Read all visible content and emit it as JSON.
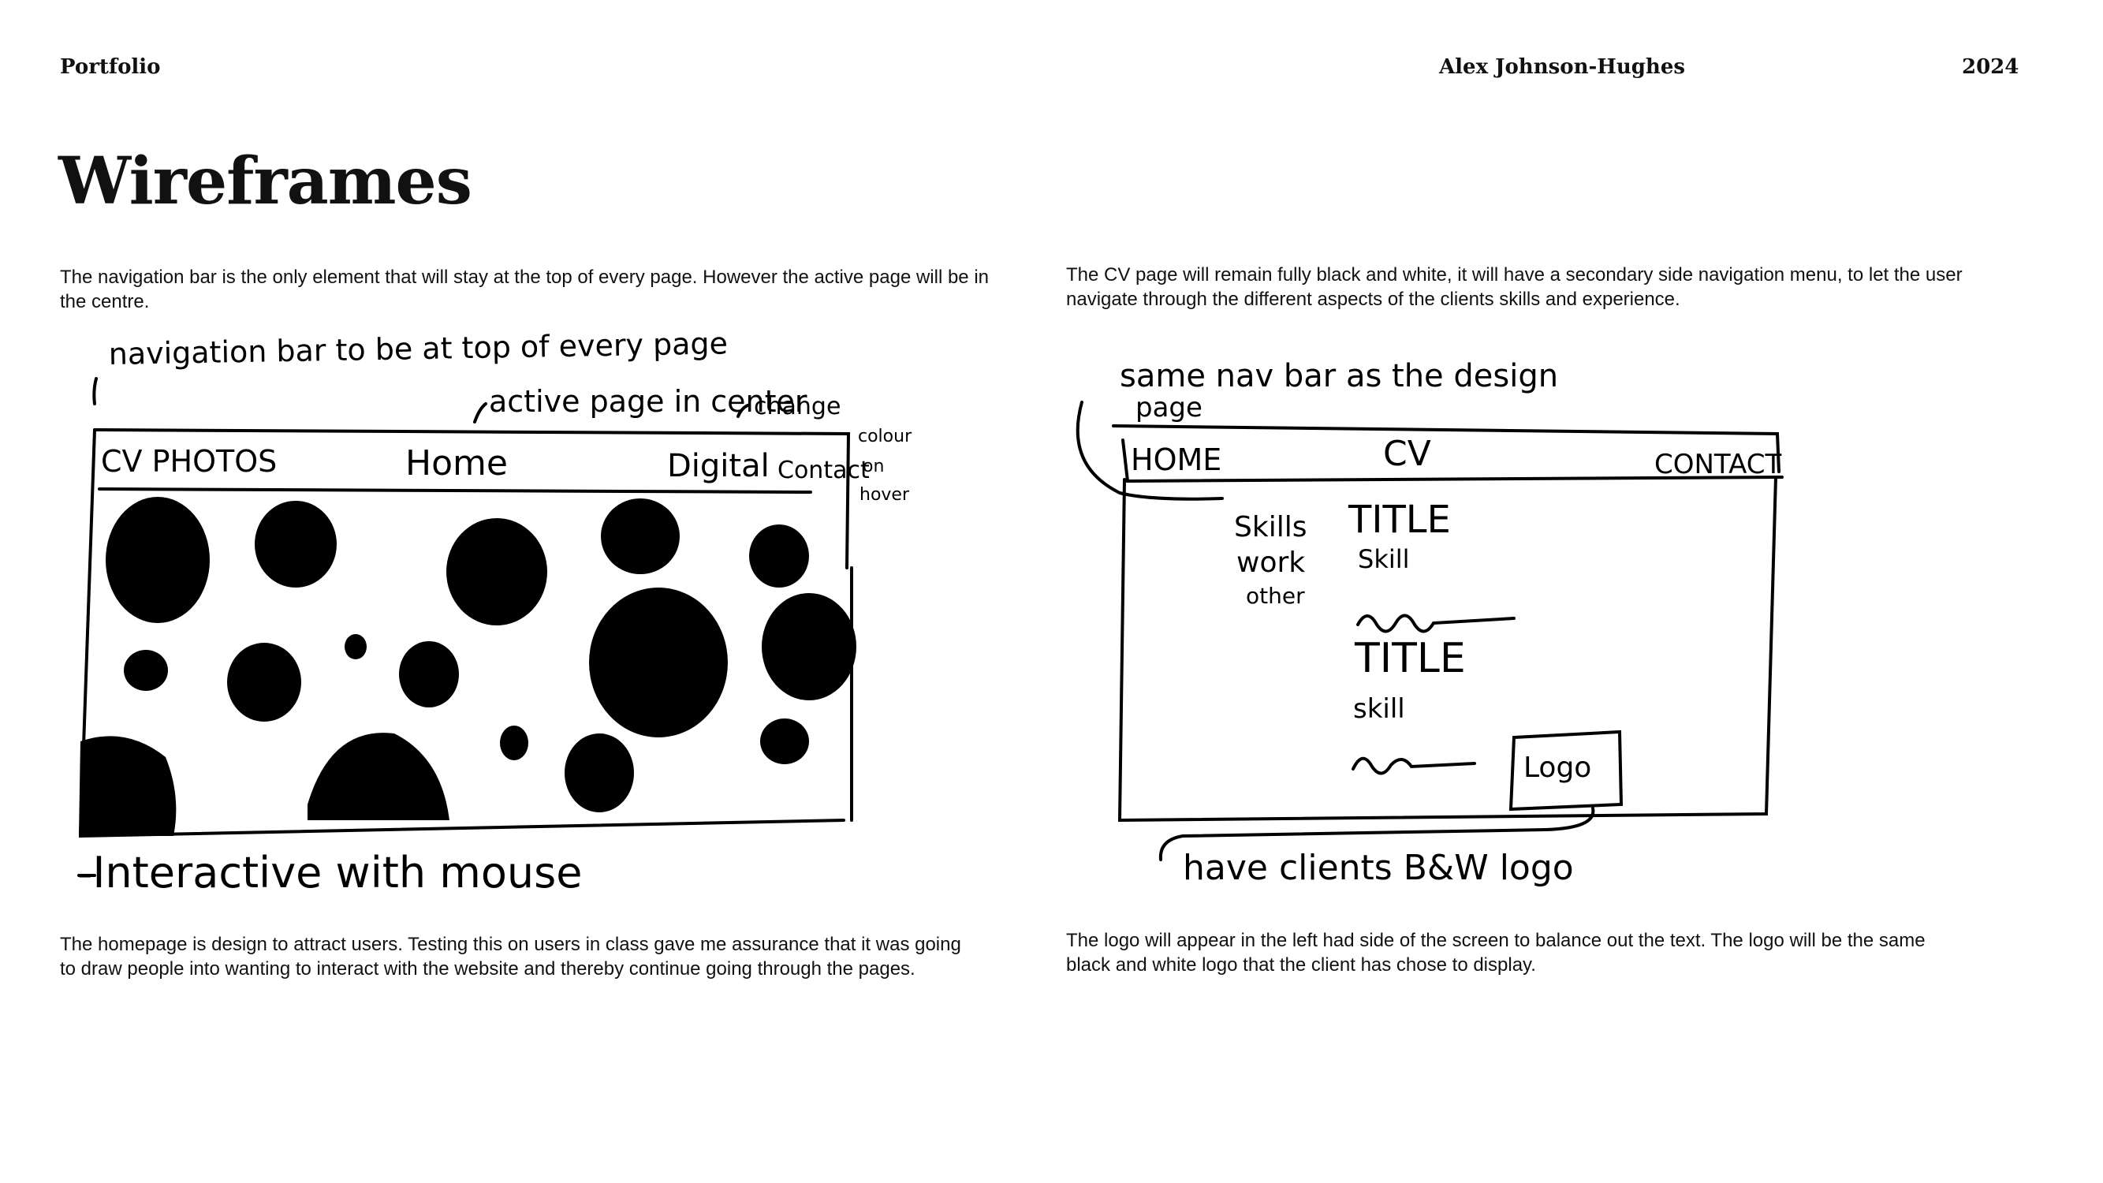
{
  "header": {
    "left": "Portfolio",
    "center": "Alex Johnson-Hughes",
    "right": "2024"
  },
  "title": "Wireframes",
  "left_column": {
    "intro": "The navigation bar is the only element that will stay at the top of every page. However the active page will be in the centre.",
    "caption": "The homepage is design to attract users. Testing this on users in class gave me assurance that it was going to draw people into wanting to interact with the website and thereby continue going through the pages.",
    "sketch": {
      "note_nav": "navigation bar to be at top of every page",
      "note_active": "active page in center",
      "note_change": "change",
      "note_colour": "colour",
      "note_on": "on",
      "note_hover": "hover",
      "nav_cv_photos": "CV PHOTOS",
      "nav_home": "Home",
      "nav_digital": "Digital",
      "nav_contact": "Contact",
      "note_interactive": "-Interactive with mouse"
    }
  },
  "right_column": {
    "intro": "The CV page will remain fully black and white, it will have a secondary side navigation menu, to let the user navigate through the different aspects of the clients skills and experience.",
    "caption": "The logo will appear in the left had side of the screen to balance out the text. The logo will be the same black and white logo that the client has chose to display.",
    "sketch": {
      "note_same_nav": "same nav bar as the design",
      "note_page": "page",
      "nav_home": "HOME",
      "nav_cv": "CV",
      "nav_contact": "CONTACT",
      "side_skills": "Skills",
      "side_work": "work",
      "side_other": "other",
      "title_1": "TITLE",
      "skill_1": "Skill",
      "title_2": "TITLE",
      "skill_2": "skill",
      "logo": "Logo",
      "note_logo": "have clients B&W logo"
    }
  }
}
